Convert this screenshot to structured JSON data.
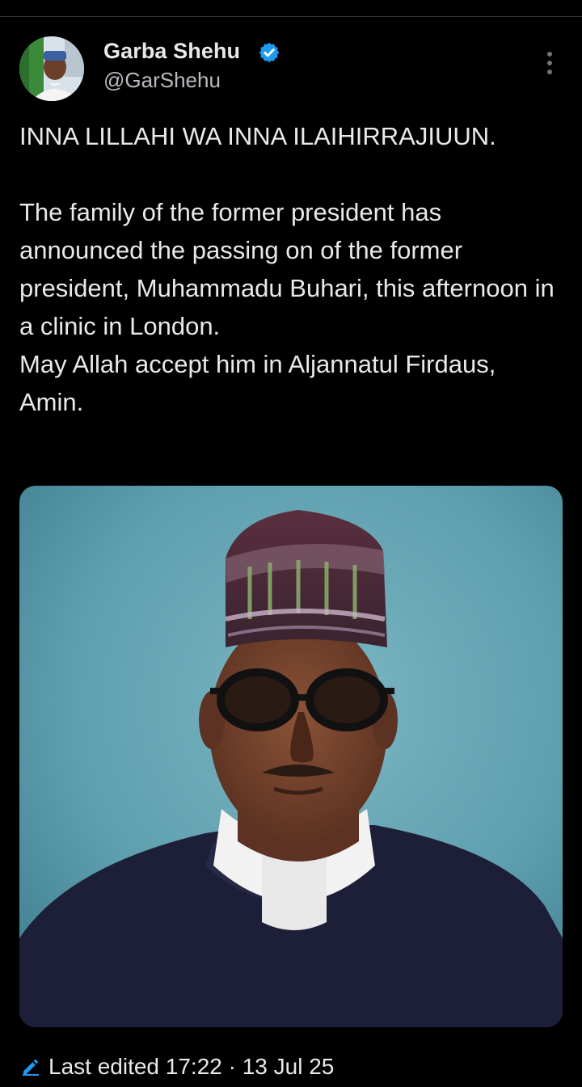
{
  "tweet": {
    "author": {
      "name": "Garba Shehu",
      "handle": "@GarShehu"
    },
    "paragraphs": [
      "INNA LILLAHI WA INNA ILAIHIRRAJIUUN.",
      "The family of the former president has announced the passing on of the former president, Muhammadu Buhari, this afternoon in a clinic in London.",
      "May Allah accept him in Aljannatul Firdaus, Amin."
    ],
    "edit_label": "Last edited 17:22 · 13 Jul 25"
  },
  "icons": {
    "verified": "verified-badge-icon",
    "more": "more-options-icon",
    "edited": "pencil-icon"
  },
  "colors": {
    "background": "#000000",
    "text": "#e7e9ea",
    "secondary": "#b8bcc0",
    "verified_blue": "#1d9bf0",
    "photo_backdrop": "#5f9fae"
  }
}
